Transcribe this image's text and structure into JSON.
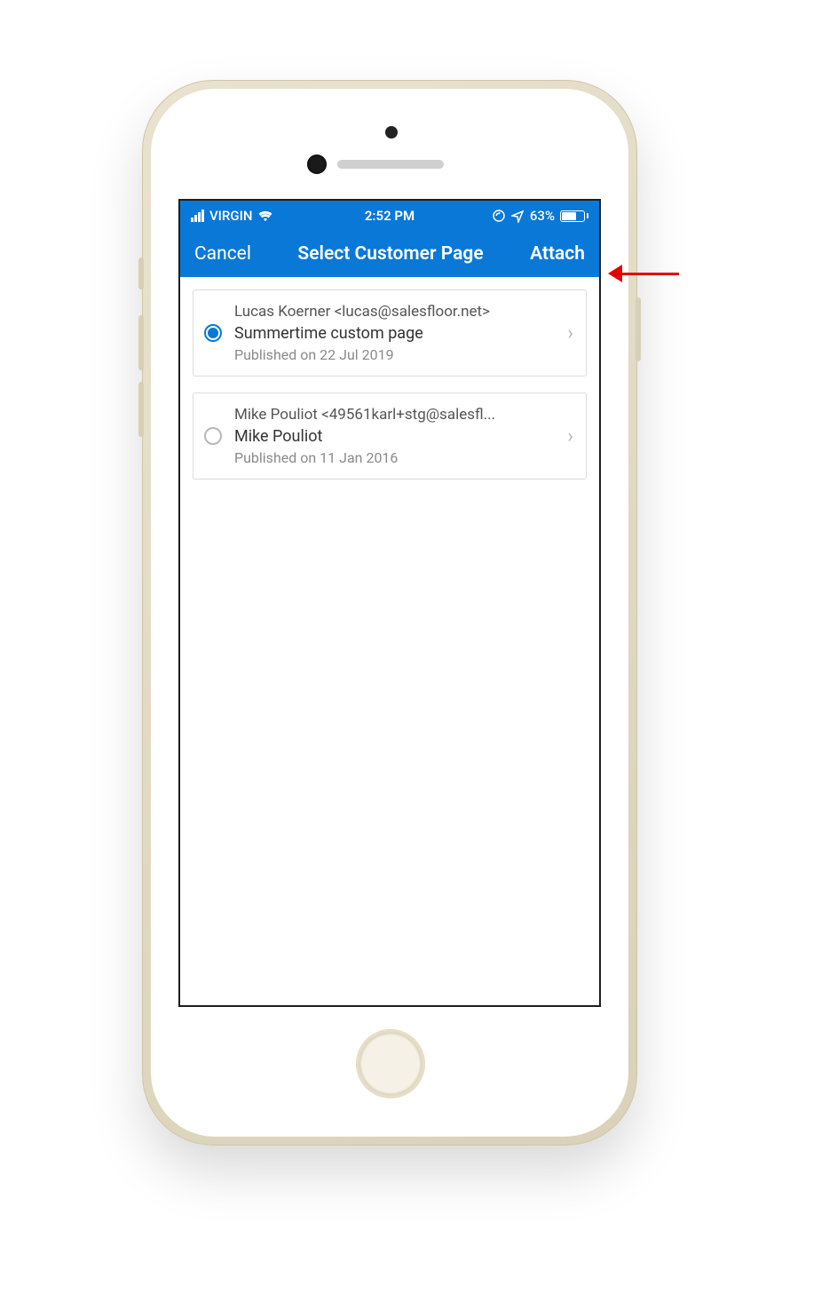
{
  "status_bar": {
    "carrier": "VIRGIN",
    "time": "2:52 PM",
    "battery_pct": "63%"
  },
  "nav": {
    "cancel_label": "Cancel",
    "title": "Select Customer Page",
    "attach_label": "Attach"
  },
  "list": {
    "items": [
      {
        "selected": true,
        "customer": "Lucas Koerner <lucas@salesfloor.net>",
        "page_name": "Summertime custom page",
        "published": "Published on 22 Jul 2019"
      },
      {
        "selected": false,
        "customer": "Mike Pouliot <49561karl+stg@salesfl...",
        "page_name": "Mike Pouliot",
        "published": "Published on 11 Jan 2016"
      }
    ]
  }
}
